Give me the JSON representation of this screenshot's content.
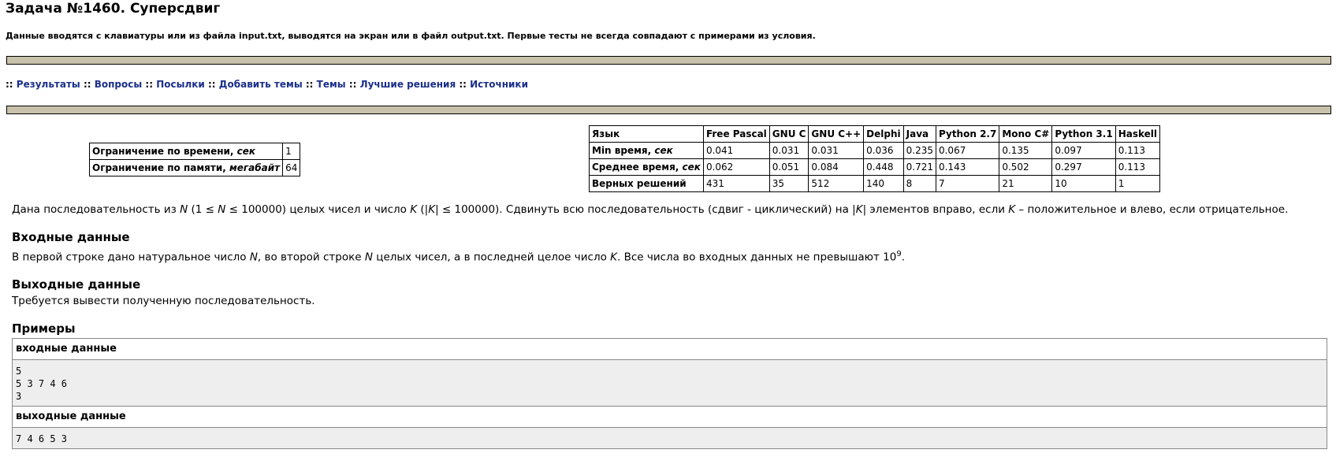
{
  "header": {
    "title": "Задача №1460. Суперсдвиг",
    "subtitle": "Данные вводятся с клавиатуры или из файла input.txt, выводятся на экран или в файл output.txt. Первые тесты не всегда совпадают с примерами из условия."
  },
  "nav": {
    "separator": "::",
    "items": [
      "Результаты",
      "Вопросы",
      "Посылки",
      "Добавить темы",
      "Темы",
      "Лучшие решения",
      "Источники"
    ]
  },
  "limits": {
    "time_label": "Ограничение по времени, ",
    "time_unit": "сек",
    "time_value": "1",
    "memory_label": "Ограничение по памяти, ",
    "memory_unit": "мегабайт",
    "memory_value": "64"
  },
  "stats": {
    "header": [
      "Язык",
      "Free Pascal",
      "GNU C",
      "GNU C++",
      "Delphi",
      "Java",
      "Python 2.7",
      "Mono C#",
      "Python 3.1",
      "Haskell"
    ],
    "rows": [
      {
        "label": "Min время, ",
        "unit": "сек",
        "values": [
          "0.041",
          "0.031",
          "0.031",
          "0.036",
          "0.235",
          "0.067",
          "0.135",
          "0.097",
          "0.113"
        ]
      },
      {
        "label": "Среднее время, ",
        "unit": "сек",
        "values": [
          "0.062",
          "0.051",
          "0.084",
          "0.448",
          "0.721",
          "0.143",
          "0.502",
          "0.297",
          "0.113"
        ]
      },
      {
        "label": "Верных решений",
        "unit": "",
        "values": [
          "431",
          "35",
          "512",
          "140",
          "8",
          "7",
          "21",
          "10",
          "1"
        ]
      }
    ]
  },
  "statement": {
    "d1": "Дана последовательность из ",
    "N": "N",
    "d2": " (1 ≤ ",
    "d3": " ≤ 100000) целых чисел и число ",
    "K": "K",
    "d4": " (|",
    "d5": "| ≤ 100000). Сдвинуть всю последовательность (сдвиг - циклический) на |",
    "d6": "| элементов вправо, если ",
    "d7": " – положительное и влево, если отрицательное."
  },
  "input_section": {
    "heading": "Входные данные",
    "t1": "В первой строке дано натуральное число ",
    "t2": ", во второй строке ",
    "t3": " целых чисел, а в последней целое число ",
    "t4": ". Все числа во входных данных не превышают 10",
    "exp": "9",
    "t5": "."
  },
  "output_section": {
    "heading": "Выходные данные",
    "text": "Требуется вывести полученную последовательность."
  },
  "examples": {
    "heading": "Примеры",
    "input_label": "входные данные",
    "input_value": "5\n5 3 7 4 6\n3",
    "output_label": "выходные данные",
    "output_value": "7 4 6 5 3"
  }
}
